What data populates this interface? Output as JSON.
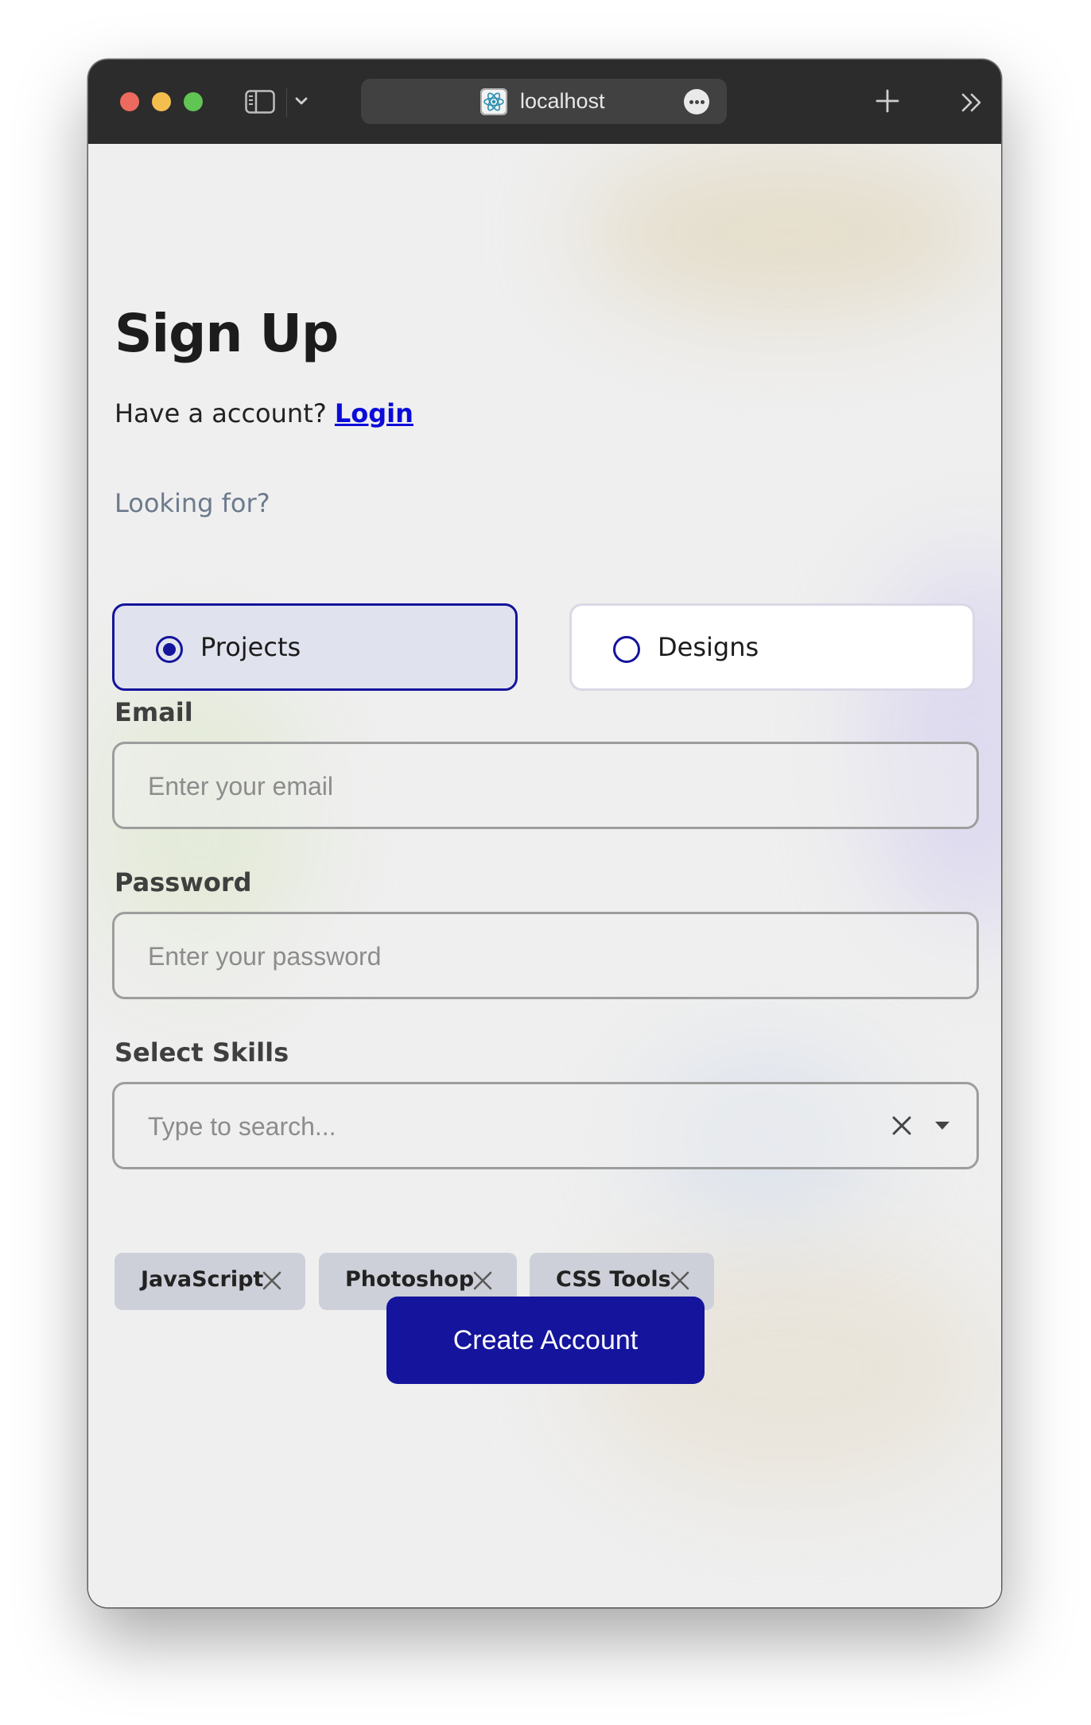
{
  "browser": {
    "url": "localhost"
  },
  "form": {
    "title": "Sign Up",
    "have_account_text": "Have a account?",
    "login_link": "Login",
    "looking_for_label": "Looking for?",
    "options": [
      {
        "label": "Projects",
        "selected": true
      },
      {
        "label": "Designs",
        "selected": false
      }
    ],
    "email": {
      "label": "Email",
      "placeholder": "Enter your email",
      "value": ""
    },
    "password": {
      "label": "Password",
      "placeholder": "Enter your password",
      "value": ""
    },
    "skills": {
      "label": "Select Skills",
      "placeholder": "Type to search...",
      "selected": [
        "JavaScript",
        "Photoshop",
        "CSS Tools"
      ]
    },
    "submit_label": "Create Account"
  },
  "colors": {
    "accent": "#14149c",
    "link": "#0b0bd9",
    "chip_bg": "#cdd0d8",
    "page_bg": "#efefef"
  },
  "icons": [
    "sidebar-toggle-icon",
    "chevron-down-icon",
    "react-favicon-icon",
    "more-icon",
    "plus-icon",
    "double-chevron-right-icon",
    "close-icon",
    "caret-down-icon"
  ]
}
